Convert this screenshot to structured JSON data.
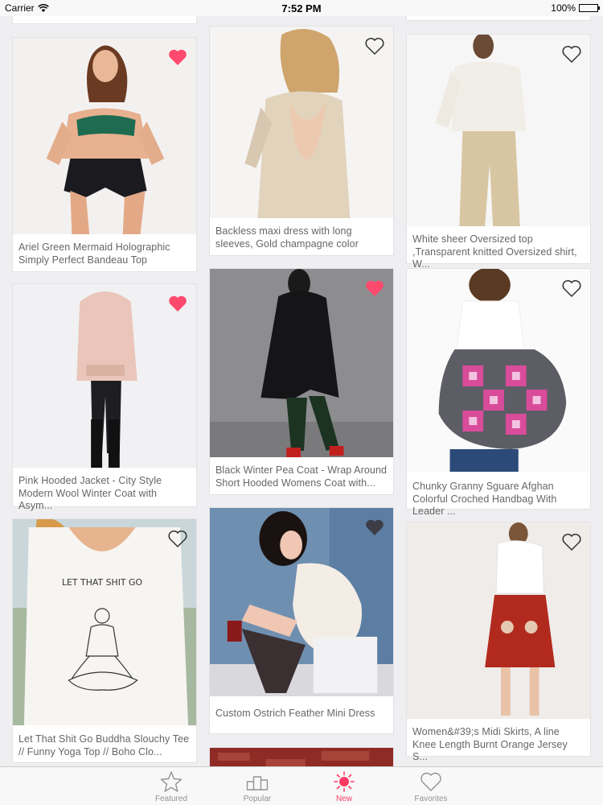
{
  "status_bar": {
    "carrier": "Carrier",
    "time": "7:52 PM",
    "battery": "100%"
  },
  "products": [
    {
      "title": "Ariel Green Mermaid Holographic Simply Perfect Bandeau Top",
      "favorited": true
    },
    {
      "title": "Backless maxi dress with long sleeves, Gold champagne color",
      "favorited": false
    },
    {
      "title": "White sheer Oversized top ,Transparent knitted Oversized shirt, W...",
      "favorited": false
    },
    {
      "title": "Pink Hooded Jacket - City Style Modern Wool Winter Coat with Asym...",
      "favorited": true
    },
    {
      "title": "Black Winter Pea Coat - Wrap Around Short Hooded Womens Coat with...",
      "favorited": true
    },
    {
      "title": "Chunky Granny Sguare Afghan Colorful Croched Handbag With Leader ...",
      "favorited": false
    },
    {
      "title": "Let That Shit Go Buddha Slouchy Tee // Funny Yoga Top // Boho Clo...",
      "favorited": false
    },
    {
      "title": "Custom Ostrich Feather Mini Dress",
      "favorited": false
    },
    {
      "title": "Women&#39;s Midi Skirts, A line Knee Length Burnt Orange Jersey S...",
      "favorited": false
    }
  ],
  "shirt_print_text": "LET THAT SHIT GO",
  "tabs": [
    {
      "label": "Featured",
      "icon": "star-icon",
      "active": false
    },
    {
      "label": "Popular",
      "icon": "podium-icon",
      "active": false
    },
    {
      "label": "New",
      "icon": "sun-icon",
      "active": true
    },
    {
      "label": "Favorites",
      "icon": "heart-icon",
      "active": false
    }
  ],
  "colors": {
    "accent": "#ff3b63",
    "heart_filled": "#ff4a6e",
    "background": "#efeff1"
  }
}
